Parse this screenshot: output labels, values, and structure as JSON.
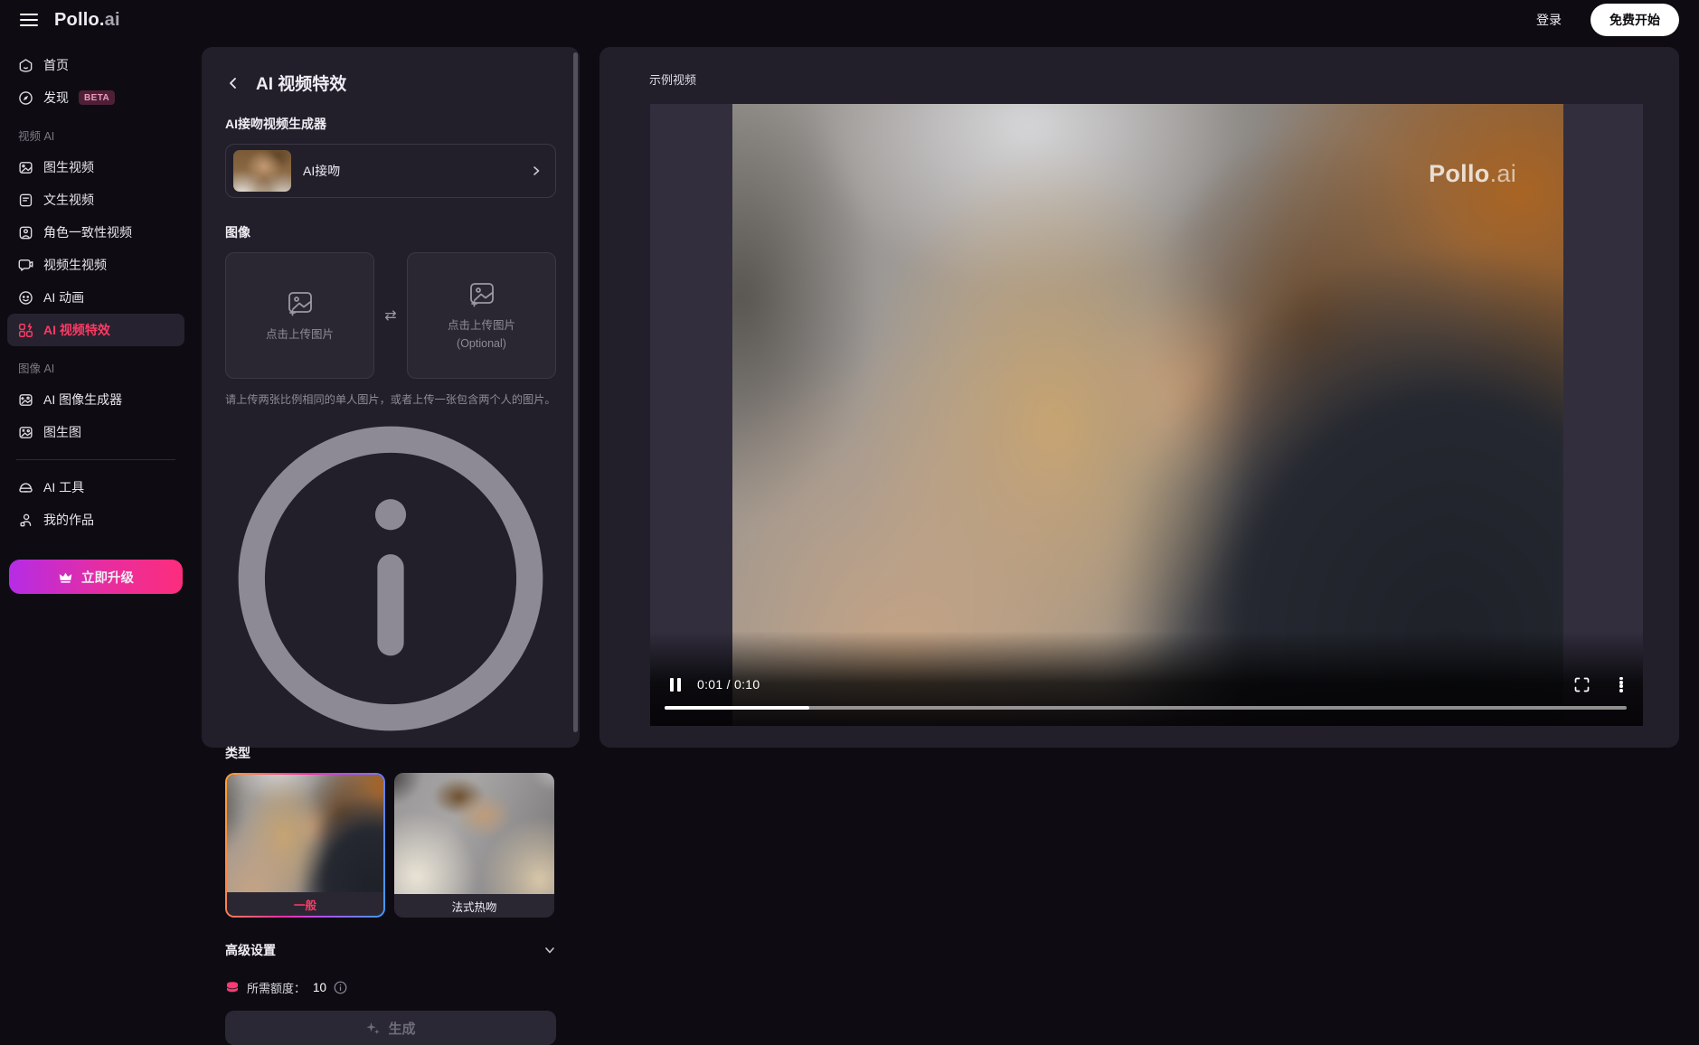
{
  "topbar": {
    "logo_main": "Pollo.",
    "logo_suffix": "ai",
    "login_label": "登录",
    "cta_label": "免费开始"
  },
  "sidebar": {
    "sections": {
      "video": "视频 AI",
      "image": "图像 AI"
    },
    "items": [
      {
        "label": "首页",
        "icon": "home-icon"
      },
      {
        "label": "发现",
        "icon": "compass-icon",
        "badge": "BETA"
      },
      {
        "label": "图生视频",
        "icon": "image-to-video-icon"
      },
      {
        "label": "文生视频",
        "icon": "text-to-video-icon"
      },
      {
        "label": "角色一致性视频",
        "icon": "character-video-icon"
      },
      {
        "label": "视频生视频",
        "icon": "video-to-video-icon"
      },
      {
        "label": "AI 动画",
        "icon": "ai-animation-icon"
      },
      {
        "label": "AI 视频特效",
        "icon": "video-effects-icon",
        "active": true
      },
      {
        "label": "AI 图像生成器",
        "icon": "image-generator-icon"
      },
      {
        "label": "图生图",
        "icon": "image-to-image-icon"
      },
      {
        "label": "AI 工具",
        "icon": "ai-tools-icon"
      },
      {
        "label": "我的作品",
        "icon": "my-works-icon"
      }
    ],
    "upgrade_label": "立即升级"
  },
  "panel": {
    "title": "AI 视频特效",
    "generator_label": "AI接吻视频生成器",
    "generator_value": "AI接吻",
    "image_section_label": "图像",
    "upload_left_text": "点击上传图片",
    "upload_right_line1": "点击上传图片",
    "upload_right_line2": "(Optional)",
    "upload_hint": "请上传两张比例相同的单人图片，或者上传一张包含两个人的图片。",
    "type_label": "类型",
    "types": [
      {
        "label": "一般",
        "selected": true
      },
      {
        "label": "法式热吻",
        "selected": false
      }
    ],
    "advanced_label": "高级设置",
    "credits_label": "所需额度：",
    "credits_value": "10",
    "generate_label": "生成"
  },
  "preview": {
    "title": "示例视频",
    "watermark_main": "Pollo",
    "watermark_suffix": ".ai",
    "player": {
      "time_display": "0:01 / 0:10",
      "progress_percent": 15
    }
  },
  "colors": {
    "accent": "#fc3a63",
    "panel": "#221f2b",
    "upgrade-from": "#b52ce6",
    "upgrade-to": "#fd2d7c",
    "cta-bg": "#ffffff"
  }
}
